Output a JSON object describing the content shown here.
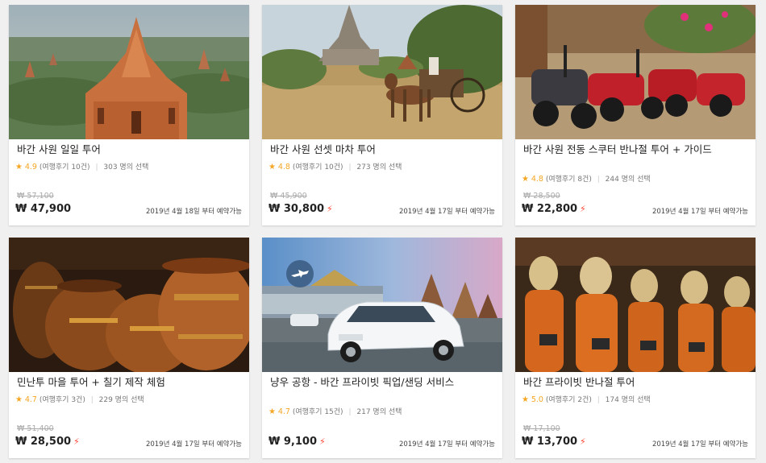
{
  "currency_symbol": "₩",
  "colors": {
    "star": "#f5a623",
    "bolt": "#ff4433",
    "strike": "#aaaaaa"
  },
  "cards": [
    {
      "title": "바간 사원 일일 투어",
      "rating": "4.9",
      "reviews": "(여행후기 10건)",
      "chosen": "303 명의 선택",
      "original_price": "₩ 57,100",
      "price": "₩ 47,900",
      "instant": false,
      "available": "2019년 4월 18일 부터 예약가능",
      "image_icon": "pagoda-landscape-photo"
    },
    {
      "title": "바간 사원 선셋 마차 투어",
      "rating": "4.8",
      "reviews": "(여행후기 10건)",
      "chosen": "273 명의 선택",
      "original_price": "₩ 45,900",
      "price": "₩ 30,800",
      "instant": true,
      "available": "2019년 4월 17일 부터 예약가능",
      "image_icon": "horse-cart-photo"
    },
    {
      "title": "바간 사원 전동 스쿠터 반나절 투어 + 가이드",
      "rating": "4.8",
      "reviews": "(여행후기 8건)",
      "chosen": "244 명의 선택",
      "original_price": "₩ 28,500",
      "price": "₩ 22,800",
      "instant": true,
      "available": "2019년 4월 17일 부터 예약가능",
      "image_icon": "e-scooter-photo"
    },
    {
      "title": "민난투 마을 투어 + 칠기 제작 체험",
      "rating": "4.7",
      "reviews": "(여행후기 3건)",
      "chosen": "229 명의 선택",
      "original_price": "₩ 51,400",
      "price": "₩ 28,500",
      "instant": true,
      "available": "2019년 4월 17일 부터 예약가능",
      "image_icon": "lacquerware-photo"
    },
    {
      "title": "냥우 공항 - 바간 프라이빗 픽업/샌딩 서비스",
      "rating": "4.7",
      "reviews": "(여행후기 15건)",
      "chosen": "217 명의 선택",
      "original_price": "",
      "price": "₩ 9,100",
      "instant": true,
      "available": "2019년 4월 17일 부터 예약가능",
      "image_icon": "airport-car-photo"
    },
    {
      "title": "바간 프라이빗 반나절 투어",
      "rating": "5.0",
      "reviews": "(여행후기 2건)",
      "chosen": "174 명의 선택",
      "original_price": "₩ 17,100",
      "price": "₩ 13,700",
      "instant": true,
      "available": "2019년 4월 17일 부터 예약가능",
      "image_icon": "monk-statues-photo"
    }
  ]
}
